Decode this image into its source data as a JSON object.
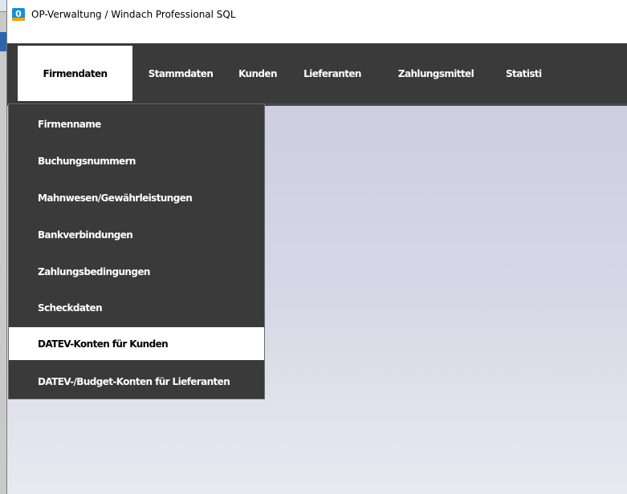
{
  "window": {
    "title": "OP-Verwaltung / Windach Professional SQL",
    "icon_text": "0"
  },
  "menu": {
    "items": [
      {
        "label": "Firmendaten",
        "active": true
      },
      {
        "label": "Stammdaten"
      },
      {
        "label": "Kunden"
      },
      {
        "label": "Lieferanten"
      },
      {
        "label": "Zahlungsmittel"
      },
      {
        "label": "Statisti"
      }
    ]
  },
  "dropdown": {
    "items": [
      {
        "label": "Firmenname"
      },
      {
        "label": "Buchungsnummern"
      },
      {
        "label": "Mahnwesen/Gewährleistungen"
      },
      {
        "label": "Bankverbindungen"
      },
      {
        "label": "Zahlungsbedingungen"
      },
      {
        "label": "Scheckdaten"
      },
      {
        "label": "DATEV-Konten für Kunden",
        "highlighted": true
      },
      {
        "label": "DATEV-/Budget-Konten für Lieferanten"
      }
    ]
  },
  "colors": {
    "menu_bg": "#3a3a3a",
    "menu_text": "#ffffff",
    "active_bg": "#ffffff",
    "content_bg_top": "#cdcfe0",
    "content_bg_bottom": "#e8e9f0",
    "app_icon": "#1a8fd6"
  },
  "icons": {
    "app_icon": "app-logo-icon"
  }
}
